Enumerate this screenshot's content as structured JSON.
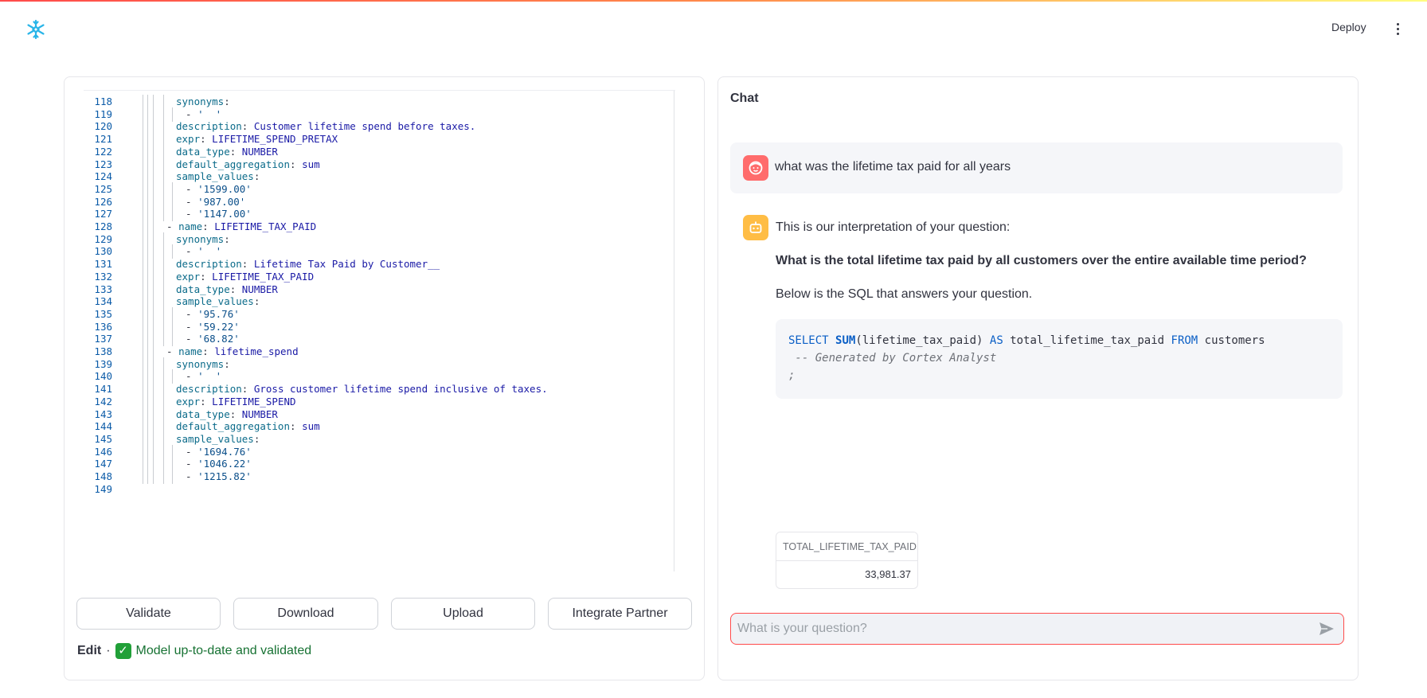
{
  "header": {
    "logo": "snowflake-icon",
    "deploy_label": "Deploy",
    "menu_icon": "kebab-menu-icon"
  },
  "editor": {
    "lines": [
      {
        "n": "118",
        "guides": 4,
        "parts": [
          [
            "k",
            "synonyms"
          ],
          [
            "p",
            ":"
          ]
        ]
      },
      {
        "n": "119",
        "guides": 5,
        "parts": [
          [
            "p",
            "- "
          ],
          [
            "s",
            "'  '"
          ]
        ]
      },
      {
        "n": "120",
        "guides": 4,
        "parts": [
          [
            "k",
            "description"
          ],
          [
            "p",
            ": "
          ],
          [
            "v",
            "Customer lifetime spend before taxes."
          ]
        ]
      },
      {
        "n": "121",
        "guides": 4,
        "parts": [
          [
            "k",
            "expr"
          ],
          [
            "p",
            ": "
          ],
          [
            "v",
            "LIFETIME_SPEND_PRETAX"
          ]
        ]
      },
      {
        "n": "122",
        "guides": 4,
        "parts": [
          [
            "k",
            "data_type"
          ],
          [
            "p",
            ": "
          ],
          [
            "v",
            "NUMBER"
          ]
        ]
      },
      {
        "n": "123",
        "guides": 4,
        "parts": [
          [
            "k",
            "default_aggregation"
          ],
          [
            "p",
            ": "
          ],
          [
            "v",
            "sum"
          ]
        ]
      },
      {
        "n": "124",
        "guides": 4,
        "parts": [
          [
            "k",
            "sample_values"
          ],
          [
            "p",
            ":"
          ]
        ]
      },
      {
        "n": "125",
        "guides": 5,
        "parts": [
          [
            "p",
            "- "
          ],
          [
            "s",
            "'1599.00'"
          ]
        ]
      },
      {
        "n": "126",
        "guides": 5,
        "parts": [
          [
            "p",
            "- "
          ],
          [
            "s",
            "'987.00'"
          ]
        ]
      },
      {
        "n": "127",
        "guides": 5,
        "parts": [
          [
            "p",
            "- "
          ],
          [
            "s",
            "'1147.00'"
          ]
        ]
      },
      {
        "n": "128",
        "guides": 3,
        "parts": [
          [
            "p",
            "- "
          ],
          [
            "k",
            "name"
          ],
          [
            "p",
            ": "
          ],
          [
            "v",
            "LIFETIME_TAX_PAID"
          ]
        ]
      },
      {
        "n": "129",
        "guides": 4,
        "parts": [
          [
            "k",
            "synonyms"
          ],
          [
            "p",
            ":"
          ]
        ]
      },
      {
        "n": "130",
        "guides": 5,
        "parts": [
          [
            "p",
            "- "
          ],
          [
            "s",
            "'  '"
          ]
        ]
      },
      {
        "n": "131",
        "guides": 4,
        "parts": [
          [
            "k",
            "description"
          ],
          [
            "p",
            ": "
          ],
          [
            "v",
            "Lifetime Tax Paid by Customer__"
          ]
        ]
      },
      {
        "n": "132",
        "guides": 4,
        "parts": [
          [
            "k",
            "expr"
          ],
          [
            "p",
            ": "
          ],
          [
            "v",
            "LIFETIME_TAX_PAID"
          ]
        ]
      },
      {
        "n": "133",
        "guides": 4,
        "parts": [
          [
            "k",
            "data_type"
          ],
          [
            "p",
            ": "
          ],
          [
            "v",
            "NUMBER"
          ]
        ]
      },
      {
        "n": "134",
        "guides": 4,
        "parts": [
          [
            "k",
            "sample_values"
          ],
          [
            "p",
            ":"
          ]
        ]
      },
      {
        "n": "135",
        "guides": 5,
        "parts": [
          [
            "p",
            "- "
          ],
          [
            "s",
            "'95.76'"
          ]
        ]
      },
      {
        "n": "136",
        "guides": 5,
        "parts": [
          [
            "p",
            "- "
          ],
          [
            "s",
            "'59.22'"
          ]
        ]
      },
      {
        "n": "137",
        "guides": 5,
        "parts": [
          [
            "p",
            "- "
          ],
          [
            "s",
            "'68.82'"
          ]
        ]
      },
      {
        "n": "138",
        "guides": 3,
        "parts": [
          [
            "p",
            "- "
          ],
          [
            "k",
            "name"
          ],
          [
            "p",
            ": "
          ],
          [
            "v",
            "lifetime_spend"
          ]
        ]
      },
      {
        "n": "139",
        "guides": 4,
        "parts": [
          [
            "k",
            "synonyms"
          ],
          [
            "p",
            ":"
          ]
        ]
      },
      {
        "n": "140",
        "guides": 5,
        "parts": [
          [
            "p",
            "- "
          ],
          [
            "s",
            "'  '"
          ]
        ]
      },
      {
        "n": "141",
        "guides": 4,
        "parts": [
          [
            "k",
            "description"
          ],
          [
            "p",
            ": "
          ],
          [
            "v",
            "Gross customer lifetime spend inclusive of taxes."
          ]
        ]
      },
      {
        "n": "142",
        "guides": 4,
        "parts": [
          [
            "k",
            "expr"
          ],
          [
            "p",
            ": "
          ],
          [
            "v",
            "LIFETIME_SPEND"
          ]
        ]
      },
      {
        "n": "143",
        "guides": 4,
        "parts": [
          [
            "k",
            "data_type"
          ],
          [
            "p",
            ": "
          ],
          [
            "v",
            "NUMBER"
          ]
        ]
      },
      {
        "n": "144",
        "guides": 4,
        "parts": [
          [
            "k",
            "default_aggregation"
          ],
          [
            "p",
            ": "
          ],
          [
            "v",
            "sum"
          ]
        ]
      },
      {
        "n": "145",
        "guides": 4,
        "parts": [
          [
            "k",
            "sample_values"
          ],
          [
            "p",
            ":"
          ]
        ]
      },
      {
        "n": "146",
        "guides": 5,
        "parts": [
          [
            "p",
            "- "
          ],
          [
            "s",
            "'1694.76'"
          ]
        ]
      },
      {
        "n": "147",
        "guides": 5,
        "parts": [
          [
            "p",
            "- "
          ],
          [
            "s",
            "'1046.22'"
          ]
        ]
      },
      {
        "n": "148",
        "guides": 5,
        "parts": [
          [
            "p",
            "- "
          ],
          [
            "s",
            "'1215.82'"
          ]
        ]
      },
      {
        "n": "149",
        "guides": 0,
        "parts": []
      }
    ]
  },
  "actions": {
    "validate": "Validate",
    "download": "Download",
    "upload": "Upload",
    "integrate": "Integrate Partner"
  },
  "status": {
    "edit_label": "Edit",
    "separator": "·",
    "check_icon": "check-mark-icon",
    "message": "Model up-to-date and validated",
    "color": "#177233"
  },
  "chat": {
    "title": "Chat",
    "user_message": "what was the lifetime tax paid for all years",
    "bot_intro": "This is our interpretation of your question:",
    "bot_interpretation": "What is the total lifetime tax paid by all customers over the entire available time period?",
    "bot_sql_intro": "Below is the SQL that answers your question.",
    "sql": {
      "select": "SELECT",
      "fn": "SUM",
      "arg": "(lifetime_tax_paid)",
      "as": "AS",
      "alias": "total_lifetime_tax_paid",
      "from": "FROM",
      "table": "customers",
      "comment": " -- Generated by Cortex Analyst",
      "terminator": ";"
    },
    "result": {
      "column": "TOTAL_LIFETIME_TAX_PAID",
      "value": "33,981.37"
    },
    "input_placeholder": "What is your question?",
    "send_icon": "send-icon"
  },
  "colors": {
    "accent": "#ff4b4b",
    "user_avatar": "#ff6c6c",
    "bot_avatar": "#ffbd45",
    "sql_keyword": "#0b5fc6"
  }
}
